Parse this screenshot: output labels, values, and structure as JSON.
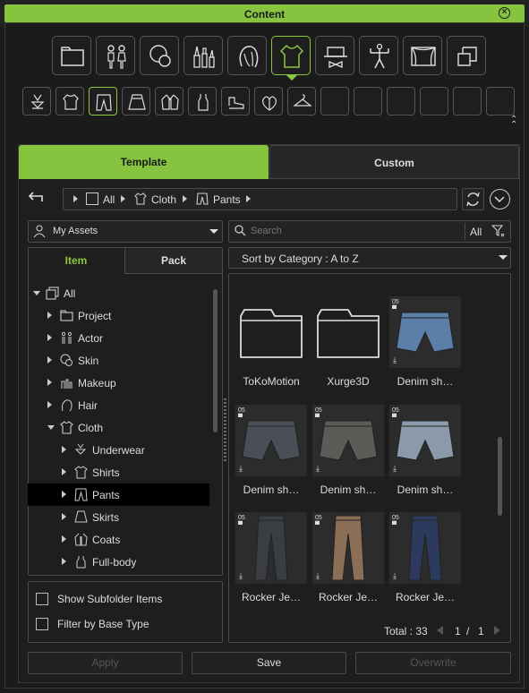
{
  "window": {
    "title": "Content",
    "close": "⊗"
  },
  "categories": [
    "folder-icon",
    "actor-icon",
    "skin-icon",
    "makeup-icon",
    "hair-icon",
    "cloth-icon",
    "accessory-icon",
    "motion-icon",
    "stage-icon",
    "scene-icon"
  ],
  "subcategories": [
    "underwear-icon",
    "shirts-icon",
    "pants-icon",
    "skirts-icon",
    "coats-icon",
    "fullbody-icon",
    "shoes-icon",
    "gloves-icon",
    "hanger-icon",
    "",
    "",
    "",
    "",
    "",
    ""
  ],
  "tabs": {
    "template": "Template",
    "custom": "Custom"
  },
  "breadcrumb": {
    "all": "All",
    "cloth": "Cloth",
    "pants": "Pants"
  },
  "assets_dropdown": "My Assets",
  "search": {
    "placeholder": "Search",
    "filter": "All"
  },
  "subtabs": {
    "item": "Item",
    "pack": "Pack"
  },
  "sort": "Sort by Category : A to Z",
  "tree": [
    {
      "label": "All"
    },
    {
      "label": "Project"
    },
    {
      "label": "Actor"
    },
    {
      "label": "Skin"
    },
    {
      "label": "Makeup"
    },
    {
      "label": "Hair"
    },
    {
      "label": "Cloth"
    },
    {
      "label": "Underwear"
    },
    {
      "label": "Shirts"
    },
    {
      "label": "Pants"
    },
    {
      "label": "Skirts"
    },
    {
      "label": "Coats"
    },
    {
      "label": "Full-body"
    }
  ],
  "options": {
    "subfolder": "Show Subfolder Items",
    "base_type": "Filter by Base Type"
  },
  "grid": [
    {
      "label": "ToKoMotion",
      "type": "folder"
    },
    {
      "label": "Xurge3D",
      "type": "folder"
    },
    {
      "label": "Denim sh…",
      "type": "shorts",
      "badge": "05",
      "color": "#5b7fa8"
    },
    {
      "label": "Denim sh…",
      "type": "shorts",
      "badge": "05",
      "color": "#4a4e56"
    },
    {
      "label": "Denim sh…",
      "type": "shorts",
      "badge": "05",
      "color": "#5a5c58"
    },
    {
      "label": "Denim sh…",
      "type": "shorts",
      "badge": "05",
      "color": "#8a9aaa"
    },
    {
      "label": "Rocker Je…",
      "type": "jeans",
      "badge": "05",
      "color": "#3a3d42"
    },
    {
      "label": "Rocker Je…",
      "type": "jeans",
      "badge": "05",
      "color": "#8a6e55"
    },
    {
      "label": "Rocker Je…",
      "type": "jeans",
      "badge": "05",
      "color": "#2c3a5e"
    }
  ],
  "pagination": {
    "total": "Total : 33",
    "page": "1",
    "sep": "/",
    "pages": "1"
  },
  "buttons": {
    "apply": "Apply",
    "save": "Save",
    "overwrite": "Overwrite"
  },
  "colors": {
    "accent": "#86c440"
  }
}
